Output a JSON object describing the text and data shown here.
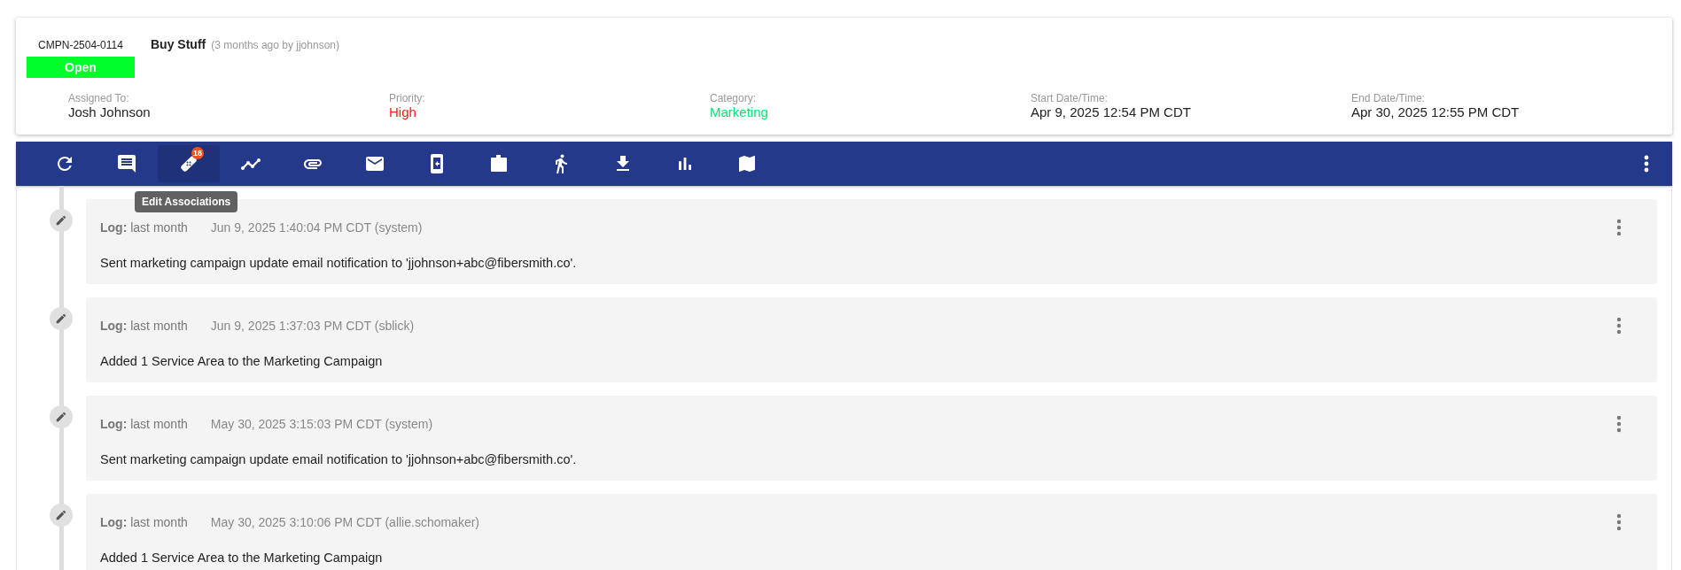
{
  "record": {
    "id": "CMPN-2504-0114",
    "status": "Open",
    "title": "Buy Stuff",
    "meta": "(3 months ago by jjohnson)"
  },
  "fields": [
    {
      "label": "Assigned To:",
      "value": "Josh Johnson",
      "color": "#222222"
    },
    {
      "label": "Priority:",
      "value": "High",
      "color": "#ff1a1a"
    },
    {
      "label": "Category:",
      "value": "Marketing",
      "color": "#00e676"
    },
    {
      "label": "Start Date/Time:",
      "value": "Apr 9, 2025 12:54 PM CDT",
      "color": "#222222"
    },
    {
      "label": "End Date/Time:",
      "value": "Apr 30, 2025 12:55 PM CDT",
      "color": "#222222"
    }
  ],
  "toolbar": {
    "buttons": [
      {
        "kind": "refresh",
        "selected": false
      },
      {
        "kind": "comment",
        "selected": false
      },
      {
        "kind": "bandage",
        "selected": true,
        "badge": "16",
        "tooltip": "Edit Associations"
      },
      {
        "kind": "trend",
        "selected": false
      },
      {
        "kind": "attachment",
        "selected": false
      },
      {
        "kind": "mail",
        "selected": false
      },
      {
        "kind": "phone",
        "selected": false
      },
      {
        "kind": "case",
        "selected": false
      },
      {
        "kind": "walk",
        "selected": false
      },
      {
        "kind": "download",
        "selected": false
      },
      {
        "kind": "bars",
        "selected": false
      },
      {
        "kind": "map",
        "selected": false
      }
    ]
  },
  "log": [
    {
      "heading": "**Log:** last month",
      "date": "Jun 9, 2025 1:40:04 PM CDT (system)",
      "text": "Sent marketing campaign update email notification to 'jjohnson+abc@fibersmith.co'."
    },
    {
      "heading": "**Log:** last month",
      "date": "Jun 9, 2025 1:37:03 PM CDT (sblick)",
      "text": "Added 1 Service Area to the Marketing Campaign"
    },
    {
      "heading": "**Log:** last month",
      "date": "May 30, 2025 3:15:03 PM CDT (system)",
      "text": "Sent marketing campaign update email notification to 'jjohnson+abc@fibersmith.co'."
    },
    {
      "heading": "**Log:** last month",
      "date": "May 30, 2025 3:10:06 PM CDT (allie.schomaker)",
      "text": "Added 1 Service Area to the Marketing Campaign"
    }
  ]
}
